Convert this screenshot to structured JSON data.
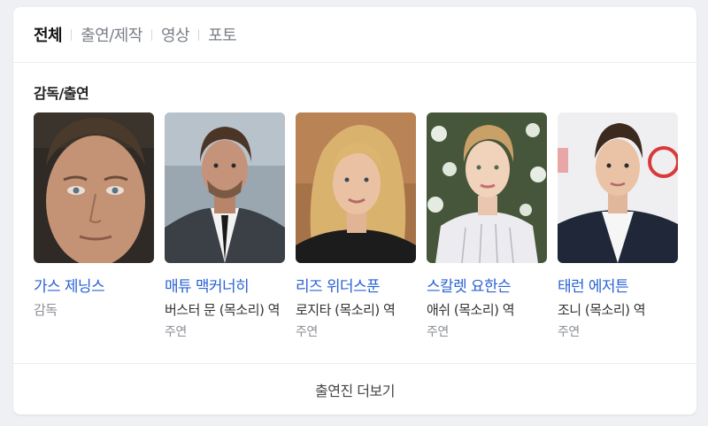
{
  "tabs": [
    {
      "label": "전체",
      "active": true
    },
    {
      "label": "출연/제작",
      "active": false
    },
    {
      "label": "영상",
      "active": false
    },
    {
      "label": "포토",
      "active": false
    }
  ],
  "section_title": "감독/출연",
  "people": [
    {
      "name": "가스 제닝스",
      "role": "감독",
      "type": ""
    },
    {
      "name": "매튜 맥커너히",
      "role": "버스터 문 (목소리) 역",
      "type": "주연"
    },
    {
      "name": "리즈 위더스푼",
      "role": "로지타 (목소리) 역",
      "type": "주연"
    },
    {
      "name": "스칼렛 요한슨",
      "role": "애쉬 (목소리) 역",
      "type": "주연"
    },
    {
      "name": "태런 에저튼",
      "role": "조니 (목소리) 역",
      "type": "주연"
    }
  ],
  "more_label": "출연진 더보기"
}
